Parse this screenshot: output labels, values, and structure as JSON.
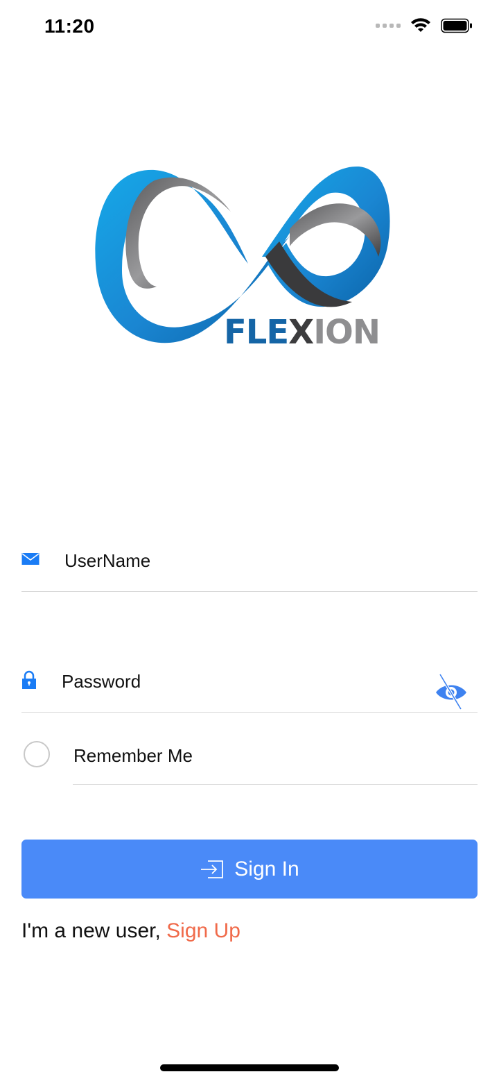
{
  "status_bar": {
    "time": "11:20"
  },
  "logo": {
    "brand_text": "FLEXION",
    "colors": {
      "blue": "#1f8fdc",
      "gray": "#8e8e90"
    }
  },
  "form": {
    "username": {
      "placeholder": "UserName",
      "value": "",
      "icon": "mail-icon"
    },
    "password": {
      "placeholder": "Password",
      "value": "",
      "icon": "lock-icon",
      "toggle_icon": "eye-slash-icon"
    },
    "remember_me": {
      "label": "Remember Me",
      "checked": false
    },
    "sign_in": {
      "label": "Sign In",
      "icon": "sign-in-icon"
    }
  },
  "signup": {
    "prefix": "I'm a new user, ",
    "link_label": "Sign Up"
  },
  "colors": {
    "accent": "#4a8af8",
    "link": "#f06a4a",
    "divider": "#d9d9d9"
  }
}
